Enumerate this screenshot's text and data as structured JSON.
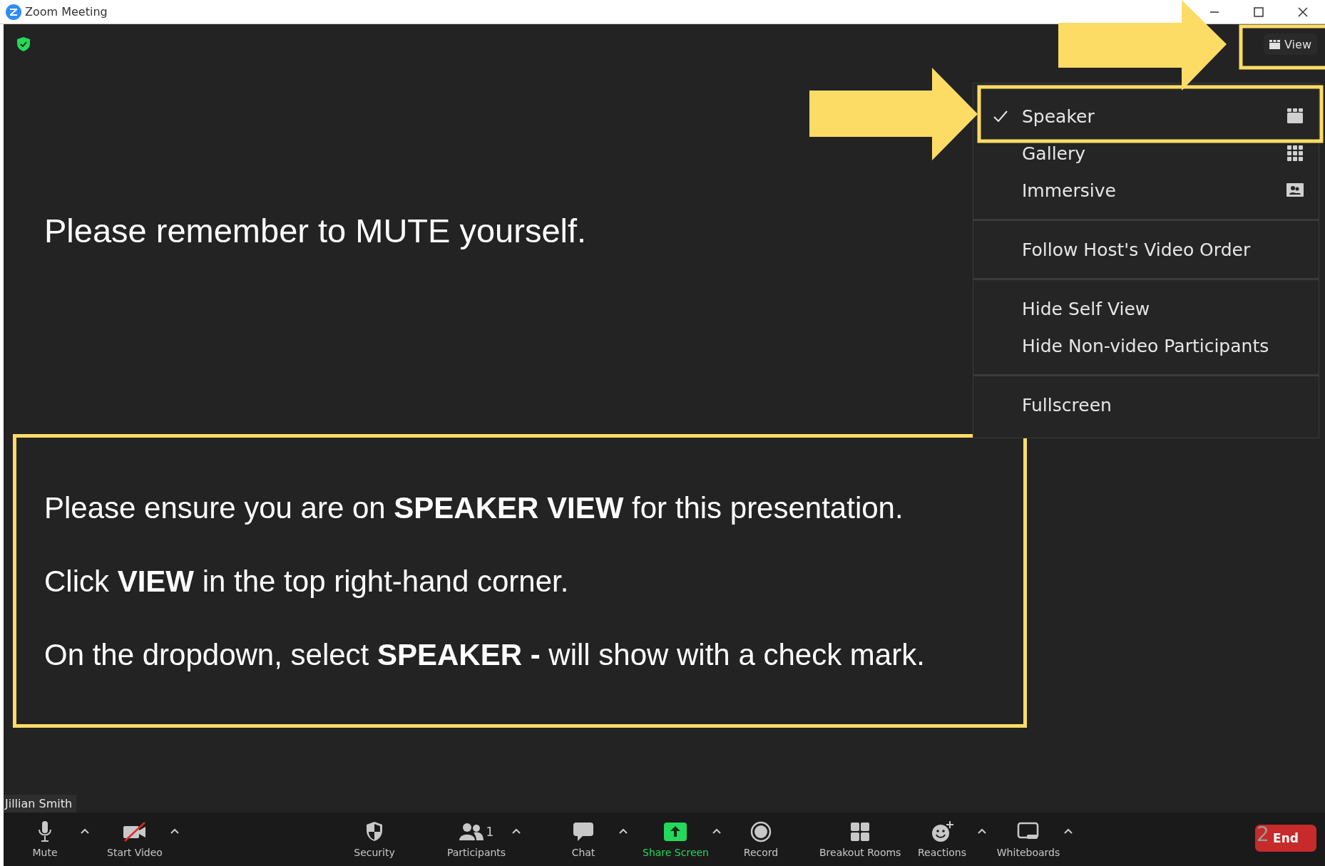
{
  "window": {
    "title": "Zoom Meeting"
  },
  "view_button": {
    "label": "View"
  },
  "view_menu": {
    "groups": [
      {
        "items": [
          {
            "label": "Speaker",
            "kind": "speaker",
            "selected": true
          },
          {
            "label": "Gallery",
            "kind": "gallery",
            "selected": false
          },
          {
            "label": "Immersive",
            "kind": "immersive",
            "selected": false
          }
        ]
      },
      {
        "items": [
          {
            "label": "Follow Host's Video Order",
            "kind": "plain",
            "selected": false
          }
        ]
      },
      {
        "items": [
          {
            "label": "Hide Self View",
            "kind": "plain",
            "selected": false
          },
          {
            "label": "Hide Non-video Participants",
            "kind": "plain",
            "selected": false
          }
        ]
      },
      {
        "items": [
          {
            "label": "Fullscreen",
            "kind": "plain",
            "selected": false
          }
        ]
      }
    ]
  },
  "notice": "Please remember to MUTE yourself.",
  "instructions": [
    "Please ensure you are on **SPEAKER VIEW** for this presentation.",
    "Click **VIEW** in the top right-hand corner.",
    "On the dropdown, select **SPEAKER -** will show with a check mark."
  ],
  "self_name": "Jillian Smith",
  "toolbar": {
    "buttons": [
      {
        "label": "Mute",
        "kind": "mic",
        "caret": true
      },
      {
        "label": "Start Video",
        "kind": "video",
        "caret": true
      },
      {
        "label": "Security",
        "kind": "security",
        "caret": false
      },
      {
        "label": "Participants",
        "kind": "participants",
        "count": "1",
        "caret": true
      },
      {
        "label": "Chat",
        "kind": "chat",
        "caret": true
      },
      {
        "label": "Share Screen",
        "kind": "share",
        "caret": true
      },
      {
        "label": "Record",
        "kind": "record",
        "caret": false
      },
      {
        "label": "Breakout Rooms",
        "kind": "breakout",
        "caret": false
      },
      {
        "label": "Reactions",
        "kind": "reactions",
        "caret": true
      },
      {
        "label": "Whiteboards",
        "kind": "whiteboard",
        "caret": true
      }
    ],
    "end": {
      "label": "End",
      "overlay_mark": "2"
    }
  }
}
